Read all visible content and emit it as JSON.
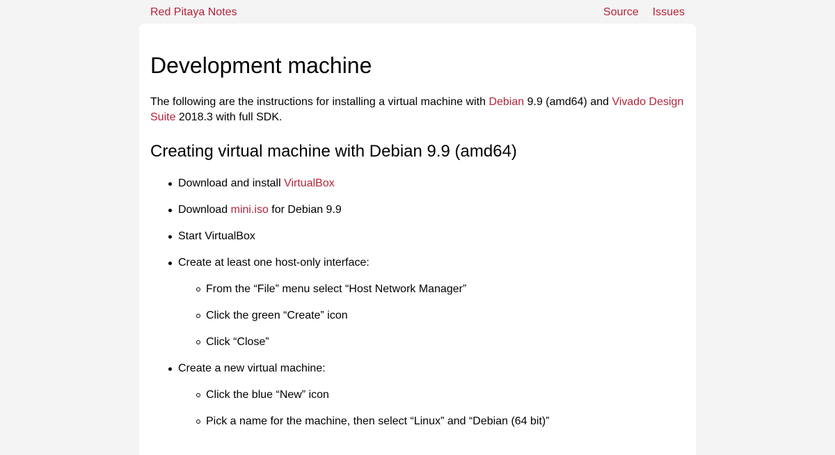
{
  "header": {
    "brand": "Red Pitaya Notes",
    "nav": {
      "source": "Source",
      "issues": "Issues"
    }
  },
  "page": {
    "title": "Development machine",
    "intro": {
      "t1": "The following are the instructions for installing a virtual machine with ",
      "link_debian": "Debian",
      "t2": " 9.9 (amd64) and ",
      "link_vivado": "Vivado Design Suite",
      "t3": " 2018.3 with full SDK."
    },
    "section1": {
      "heading": "Creating virtual machine with Debian 9.9 (amd64)",
      "items": [
        {
          "prefix": "Download and install ",
          "link": "VirtualBox",
          "suffix": ""
        },
        {
          "prefix": "Download ",
          "link": "mini.iso",
          "suffix": " for Debian 9.9"
        },
        {
          "prefix": "Start VirtualBox"
        },
        {
          "prefix": "Create at least one host-only interface:",
          "sub": [
            "From the “File” menu select “Host Network Manager”",
            "Click the green “Create” icon",
            "Click “Close”"
          ]
        },
        {
          "prefix": "Create a new virtual machine:",
          "sub": [
            "Click the blue “New” icon",
            "Pick a name for the machine, then select “Linux” and “Debian (64 bit)”"
          ]
        }
      ]
    }
  },
  "colors": {
    "link": "#b3243a",
    "background": "#f4f4f4",
    "card": "#ffffff"
  }
}
